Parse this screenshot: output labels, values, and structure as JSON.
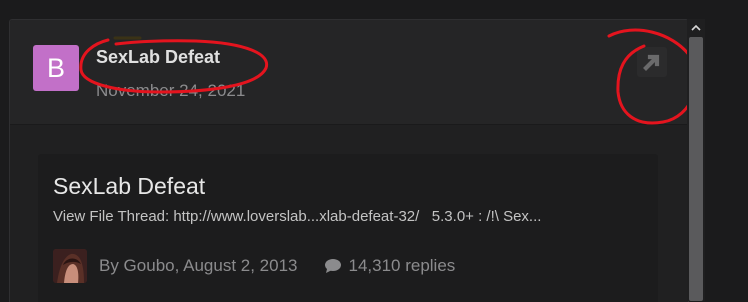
{
  "post": {
    "avatar_letter": "B",
    "title": "SexLab Defeat",
    "date": "November 24, 2021"
  },
  "share_icon": "external-link-icon",
  "embed": {
    "title": "SexLab Defeat",
    "description": "View File Thread: http://www.loverslab...xlab-defeat-32/   5.3.0+ : /!\\ Sex...",
    "author_line": "By Goubo, August 2, 2013",
    "replies": "14,310 replies",
    "reply_icon": "speech-bubble-icon"
  },
  "colors": {
    "avatar_bg": "#c270c8",
    "annotation_red": "#e4141e",
    "panel_bg": "#202021",
    "header_bg": "#252526"
  }
}
